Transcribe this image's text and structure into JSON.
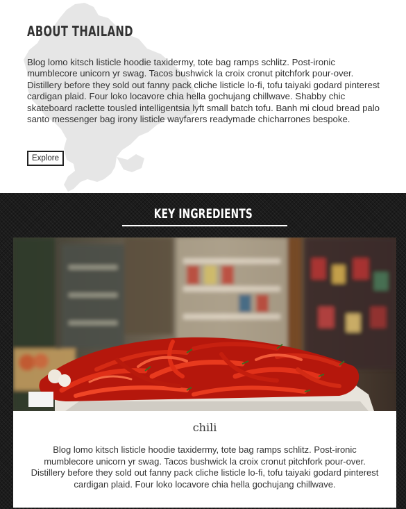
{
  "about": {
    "title": "About Thailand",
    "body": "Blog lomo kitsch listicle hoodie taxidermy, tote bag ramps schlitz. Post-ironic mumblecore unicorn yr swag. Tacos bushwick la croix cronut pitchfork pour-over. Distillery before they sold out fanny pack cliche listicle lo-fi, tofu taiyaki godard pinterest cardigan plaid. Four loko locavore chia hella gochujang chillwave. Shabby chic skateboard raclette tousled intelligentsia lyft small batch tofu. Banh mi cloud bread palo santo messenger bag irony listicle wayfarers readymade chicharrones bespoke.",
    "button_label": "Explore"
  },
  "ingredients": {
    "title": "Key Ingredients",
    "card": {
      "title": "chili",
      "body": "Blog lomo kitsch listicle hoodie taxidermy, tote bag ramps schlitz. Post-ironic mumblecore unicorn yr swag. Tacos bushwick la croix cronut pitchfork pour-over. Distillery before they sold out fanny pack cliche listicle lo-fi, tofu taiyaki godard pinterest cardigan plaid. Four loko locavore chia hella gochujang chillwave."
    }
  },
  "colors": {
    "text": "#333333",
    "dark_section": "#1c1c1c",
    "map_silhouette": "#e8e8e8",
    "chili_red": "#c81c10"
  }
}
